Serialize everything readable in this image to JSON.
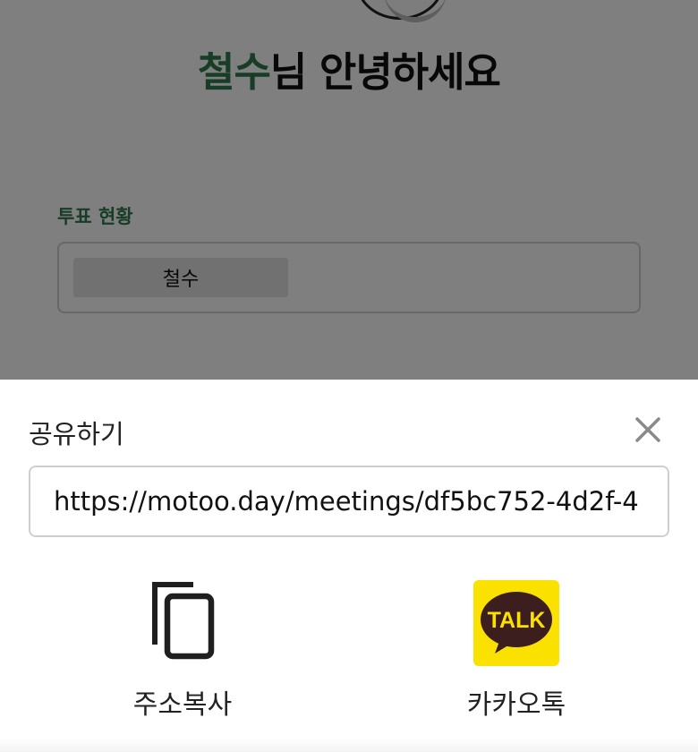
{
  "app": {
    "greeting": {
      "name": "철수",
      "suffix": "님 안녕하세요"
    },
    "vote_status": {
      "title": "투표 현황",
      "items": [
        {
          "label": "철수"
        }
      ]
    }
  },
  "share_sheet": {
    "title": "공유하기",
    "url_value": "https://motoo.day/meetings/df5bc752-4d2f-4",
    "options": [
      {
        "label": "주소복사",
        "icon": "copy-icon"
      },
      {
        "label": "카카오톡",
        "icon": "kakaotalk-icon",
        "icon_text": "TALK"
      }
    ]
  },
  "colors": {
    "accent": "#2f7a4e",
    "overlay": "rgba(0,0,0,0.5)",
    "kakao_yellow": "#fae100",
    "kakao_brown": "#3c1e1e"
  }
}
